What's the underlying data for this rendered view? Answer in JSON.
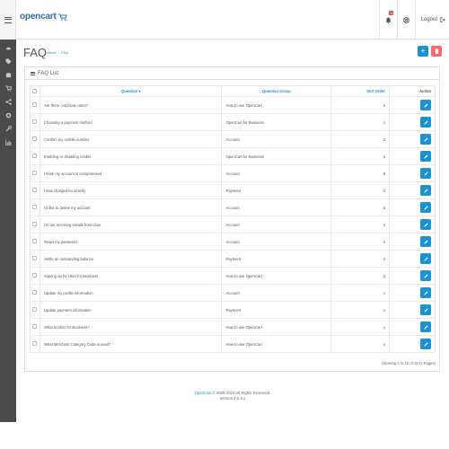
{
  "header": {
    "logo_text": "opencart",
    "notification_count": "3",
    "logout_label": "Logout"
  },
  "sidebar": {
    "items": [
      {
        "icon": "dashboard-icon"
      },
      {
        "icon": "tag-icon"
      },
      {
        "icon": "puzzle-icon"
      },
      {
        "icon": "cart-icon"
      },
      {
        "icon": "share-icon"
      },
      {
        "icon": "gear-icon"
      },
      {
        "icon": "wrench-icon"
      },
      {
        "icon": "chart-icon"
      }
    ]
  },
  "page": {
    "title": "FAQ",
    "breadcrumb": [
      "Home",
      "FAQ"
    ],
    "add_button_icon": "+",
    "delete_button_icon": "trash-icon"
  },
  "panel": {
    "title": "FAQ List",
    "columns": {
      "question": "Question",
      "group": "Question Group",
      "sort": "Sort Order",
      "action": "Action"
    },
    "rows": [
      {
        "question": "Are there corporate rates?",
        "group": "How to use OpenCart",
        "sort": "3"
      },
      {
        "question": "Choosing a payment method",
        "group": "OpenCart for Business",
        "sort": "1"
      },
      {
        "question": "Confirm my mobile number",
        "group": "Account",
        "sort": "3"
      },
      {
        "question": "Enabling or disabling credits",
        "group": "OpenCart for Business",
        "sort": "2"
      },
      {
        "question": "I think my account is compromised",
        "group": "Account",
        "sort": "6"
      },
      {
        "question": "I was charged incorrectly",
        "group": "Payment",
        "sort": "3"
      },
      {
        "question": "I'd like to delete my account",
        "group": "Account",
        "sort": "5"
      },
      {
        "question": "I'm not receiving emails from Uber",
        "group": "Account",
        "sort": "4"
      },
      {
        "question": "Reset my password",
        "group": "Account",
        "sort": "2"
      },
      {
        "question": "Settle an outstanding balance",
        "group": "Payment",
        "sort": "2"
      },
      {
        "question": "Signing up for Uber for Business",
        "group": "How to use OpenCart",
        "sort": "2"
      },
      {
        "question": "Update my profile information",
        "group": "Account",
        "sort": "1"
      },
      {
        "question": "Update payment information",
        "group": "Payment",
        "sort": "1"
      },
      {
        "question": "What is Uber for Business?",
        "group": "How to use OpenCart",
        "sort": "1"
      },
      {
        "question": "What Merchant Category Code is used?",
        "group": "How to use OpenCart",
        "sort": "4"
      }
    ],
    "pagination": "Showing 1 to 15 of 15 (1 Pages)"
  },
  "footer": {
    "line1_brand": "OpenCart",
    "line1_rest": " © 2009-2015 All Rights Reserved.",
    "line2": "Version 2.0.3.1"
  },
  "colors": {
    "primary": "#1e91cf",
    "danger": "#f56b6b",
    "sidebar": "#4a4a4a"
  }
}
